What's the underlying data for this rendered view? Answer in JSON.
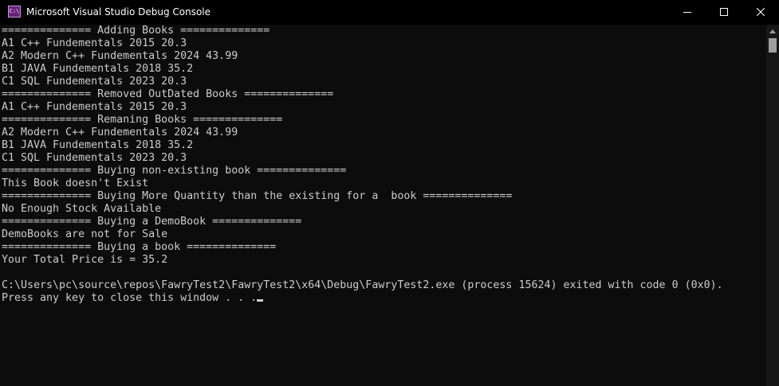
{
  "window": {
    "title": "Microsoft Visual Studio Debug Console",
    "app_icon_text": "C:\\",
    "accent_color": "#68217a",
    "background_color": "#0c0c0c",
    "text_color": "#cccccc",
    "controls": {
      "minimize_icon": "minimize-icon",
      "maximize_icon": "maximize-icon",
      "close_icon": "close-icon"
    }
  },
  "console": {
    "lines": [
      "============== Adding Books ==============",
      "A1 C++ Fundementals 2015 20.3",
      "A2 Modern C++ Fundementals 2024 43.99",
      "B1 JAVA Fundementals 2018 35.2",
      "C1 SQL Fundementals 2023 20.3",
      "============== Removed OutDated Books ==============",
      "A1 C++ Fundementals 2015 20.3",
      "============== Remaning Books ==============",
      "A2 Modern C++ Fundementals 2024 43.99",
      "B1 JAVA Fundementals 2018 35.2",
      "C1 SQL Fundementals 2023 20.3",
      "============== Buying non-existing book ==============",
      "This Book doesn't Exist",
      "============== Buying More Quantity than the existing for a  book ==============",
      "No Enough Stock Available",
      "============== Buying a DemoBook ==============",
      "DemoBooks are not for Sale",
      "============== Buying a book ==============",
      "Your Total Price is = 35.2",
      "",
      "C:\\Users\\pc\\source\\repos\\FawryTest2\\FawryTest2\\x64\\Debug\\FawryTest2.exe (process 15624) exited with code 0 (0x0).",
      "Press any key to close this window . . ."
    ]
  },
  "scrollbar": {
    "up_arrow_icon": "scroll-up-arrow-icon"
  }
}
